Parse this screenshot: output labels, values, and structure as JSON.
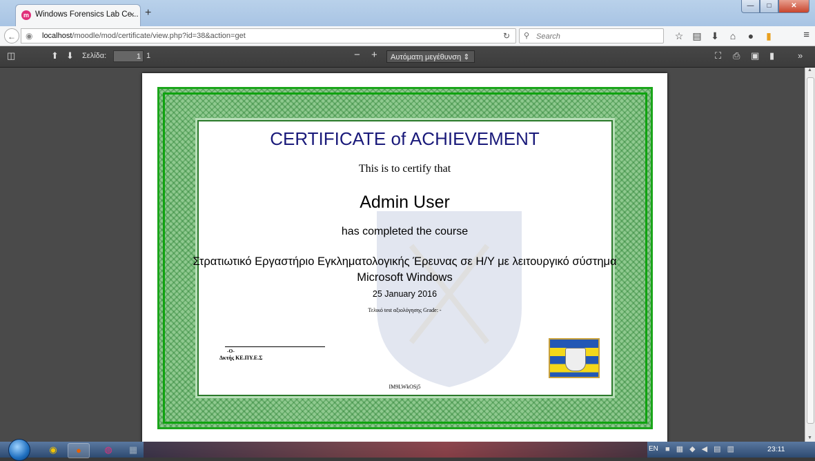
{
  "window": {
    "tab_title": "Windows Forensics Lab Ce...",
    "tab_close": "×",
    "new_tab": "+",
    "controls": {
      "minimize": "—",
      "maximize": "□",
      "close": "✕"
    }
  },
  "navbar": {
    "url_host": "localhost",
    "url_path": "/moodle/mod/certificate/view.php?id=38&action=get",
    "search_placeholder": "Search",
    "icons": [
      "star-icon",
      "reading-list-icon",
      "download-icon",
      "home-icon",
      "chat-icon",
      "pocket-icon"
    ]
  },
  "pdf_toolbar": {
    "page_label": "Σελίδα:",
    "page_value": "1",
    "page_total": "1",
    "zoom_out": "−",
    "zoom_in": "+",
    "zoom_selected": "Αυτόματη μεγέθυνση"
  },
  "certificate": {
    "title": "CERTIFICATE of ACHIEVEMENT",
    "intro": "This is to certify that",
    "name": "Admin User",
    "completed": "has completed the course",
    "course_line1": "Στρατιωτικό Εργαστήριο Εγκληματολογικής Έρευνας σε Η/Υ με λειτουργικό σύστημα",
    "course_line2": "Microsoft Windows",
    "date": "25 January 2016",
    "grade": "Τελικό test αξιολόγησης Grade: -",
    "signer_rank": "-O-",
    "signer_name": "Δκτής ΚΕ.ΠΥ.Ε.Σ",
    "code": "IM9LWkOSj5",
    "colors": {
      "border": "#1aa61a",
      "title": "#1a1a7a"
    }
  },
  "taskbar": {
    "lang": "EN",
    "clock": "23:11"
  }
}
